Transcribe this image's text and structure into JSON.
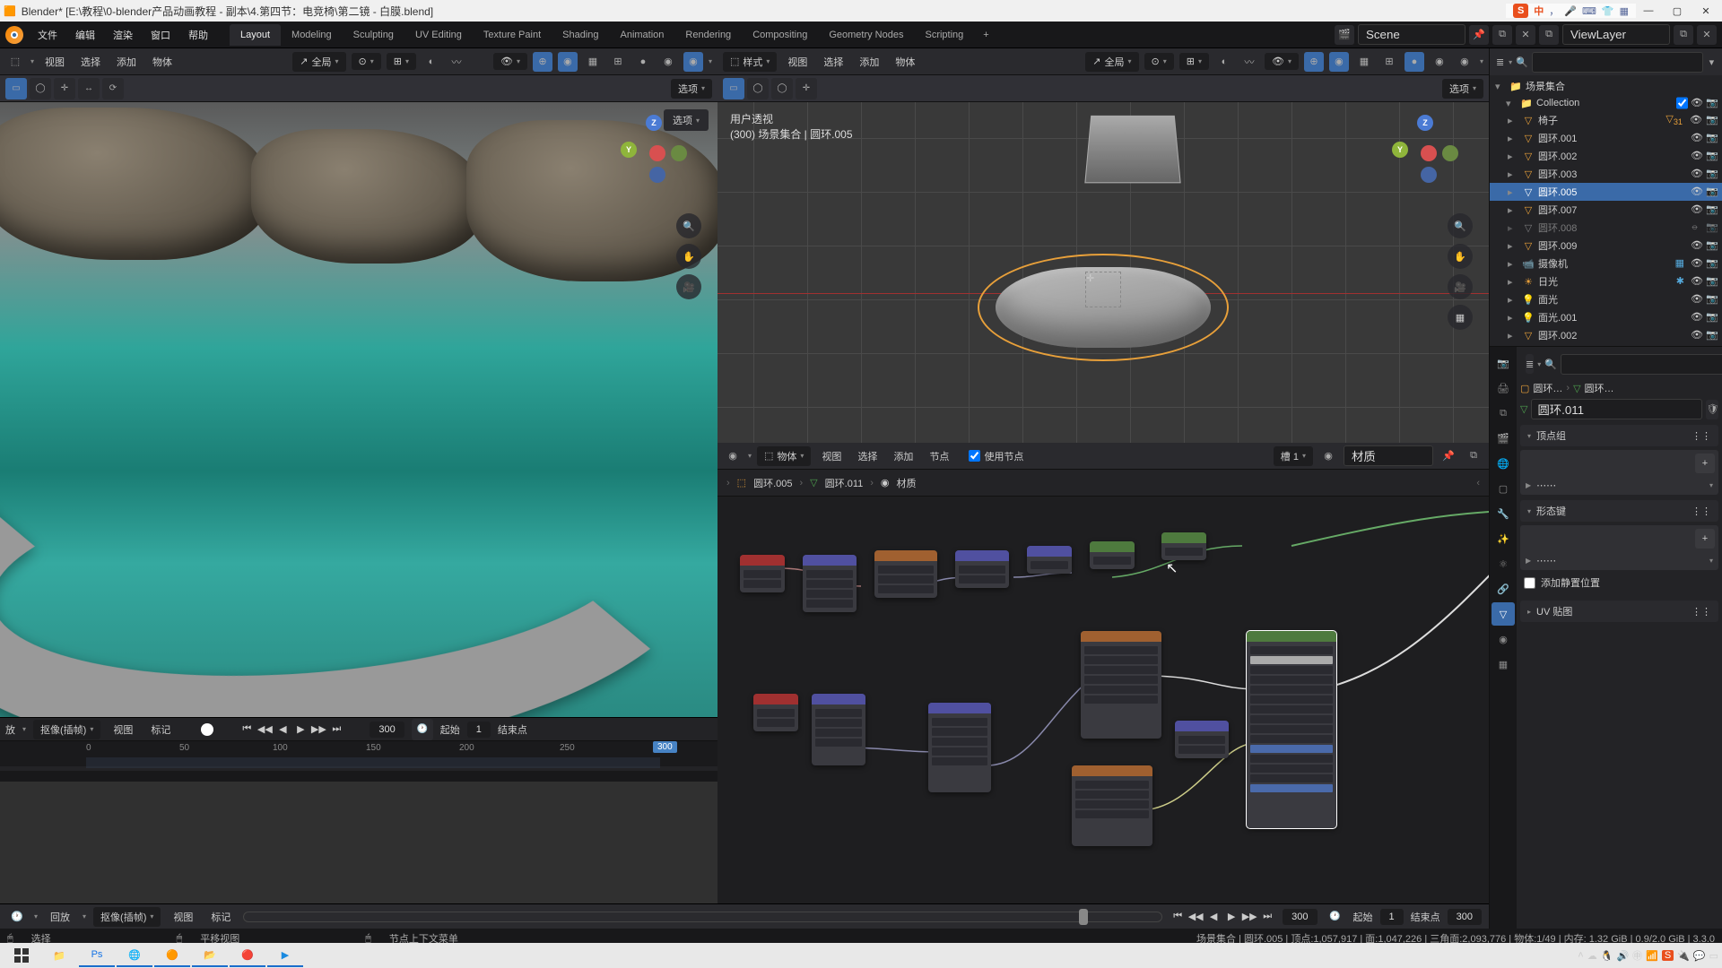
{
  "titlebar": "Blender* [E:\\教程\\0-blender产品动画教程 - 副本\\4.第四节：电竞椅\\第二镜 - 白膜.blend]",
  "ime": {
    "badge": "S",
    "lang": "中"
  },
  "menubar": [
    "文件",
    "编辑",
    "渲染",
    "窗口",
    "帮助"
  ],
  "workspaces": [
    "Layout",
    "Modeling",
    "Sculpting",
    "UV Editing",
    "Texture Paint",
    "Shading",
    "Animation",
    "Rendering",
    "Compositing",
    "Geometry Nodes",
    "Scripting"
  ],
  "active_ws": "Layout",
  "scene": {
    "name": "Scene",
    "layer": "ViewLayer"
  },
  "left_vp": {
    "menus": [
      "视图",
      "选择",
      "添加",
      "物体"
    ],
    "mode": "全局",
    "opt": "选项"
  },
  "right_vp": {
    "mode_label": "样式",
    "menus": [
      "视图",
      "选择",
      "添加",
      "物体"
    ],
    "mode": "全局",
    "opt": "选项",
    "info1": "用户透视",
    "info2": "(300) 场景集合 | 圆环.005"
  },
  "dope": {
    "menus": [
      "抠像(插帧)",
      "视图",
      "标记"
    ],
    "frames": [
      0,
      50,
      100,
      150,
      200,
      250,
      300
    ],
    "current": 300,
    "start_lbl": "起始",
    "start": 1,
    "end_lbl": "结束点"
  },
  "timeline": {
    "menus": [
      "回放",
      "抠像(插帧)",
      "视图",
      "标记"
    ],
    "current": 300,
    "start_lbl": "起始",
    "start": 1,
    "end_lbl": "结束点",
    "end": 300
  },
  "status": {
    "left1": "选择",
    "left2": "平移视图",
    "left3": "节点上下文菜单",
    "right": "场景集合 | 圆环.005 | 顶点:1,057,917 | 面:1,047,226 | 三角面:2,093,776 | 物体:1/49 | 内存: 1.32 GiB | 0.9/2.0 GiB | 3.3.0"
  },
  "node_ed": {
    "mode": "物体",
    "menus": [
      "视图",
      "选择",
      "添加",
      "节点"
    ],
    "use_nodes": "使用节点",
    "slot": "槽 1",
    "mat_lbl": "材质",
    "crumb_obj": "圆环.005",
    "crumb_mesh": "圆环.011",
    "crumb_mat": "材质"
  },
  "outliner": {
    "root": "场景集合",
    "items": [
      {
        "name": "Collection",
        "type": "coll",
        "cb": true
      },
      {
        "name": "椅子",
        "type": "mesh",
        "restrict": "31"
      },
      {
        "name": "圆环.001",
        "type": "mesh"
      },
      {
        "name": "圆环.002",
        "type": "mesh"
      },
      {
        "name": "圆环.003",
        "type": "mesh"
      },
      {
        "name": "圆环.005",
        "type": "mesh",
        "sel": true
      },
      {
        "name": "圆环.007",
        "type": "mesh"
      },
      {
        "name": "圆环.008",
        "type": "mesh",
        "hidden": true
      },
      {
        "name": "圆环.009",
        "type": "mesh"
      },
      {
        "name": "摄像机",
        "type": "cam"
      },
      {
        "name": "日光",
        "type": "sun"
      },
      {
        "name": "面光",
        "type": "area"
      },
      {
        "name": "面光.001",
        "type": "area"
      },
      {
        "name": "圆环.002",
        "type": "mesh"
      }
    ]
  },
  "props": {
    "crumb1": "圆环…",
    "crumb2": "圆环…",
    "mesh_name": "圆环.011",
    "panel_vg": "顶点组",
    "panel_sk": "形态键",
    "add_rest": "添加静置位置",
    "panel_uv": "UV 贴图"
  }
}
